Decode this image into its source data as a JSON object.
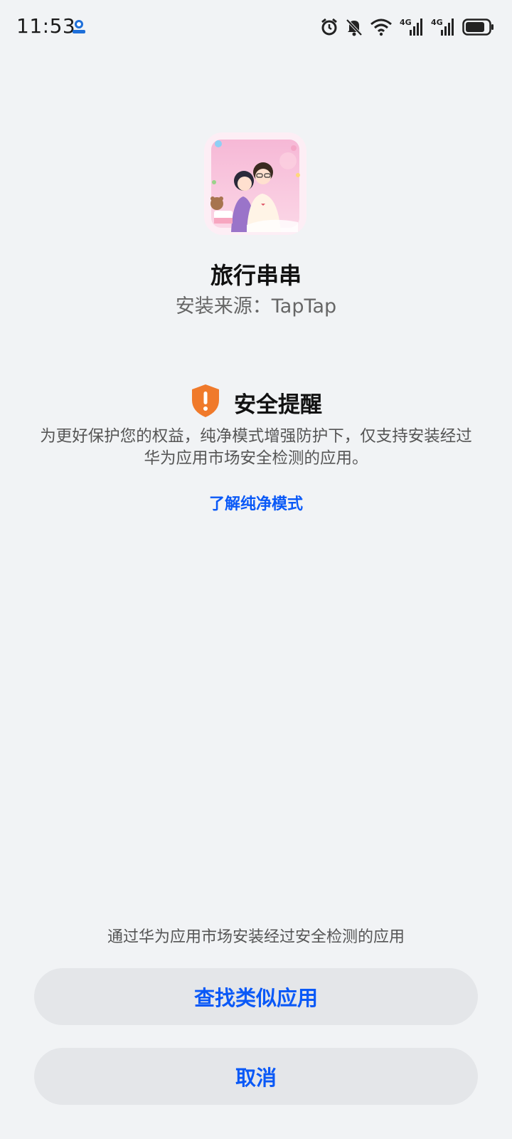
{
  "status_bar": {
    "time": "11:53",
    "icons": [
      "app-notification-icon",
      "alarm-icon",
      "mute-icon",
      "wifi-icon",
      "signal-4g-icon",
      "signal-4g-icon",
      "battery-icon"
    ],
    "network_labels": [
      "4G",
      "4G"
    ]
  },
  "app": {
    "name": "旅行串串",
    "install_source": "安装来源：TapTap"
  },
  "notice": {
    "icon": "shield-alert-icon",
    "title": "安全提醒",
    "body": "为更好保护您的权益，纯净模式增强防护下，仅支持安装经过华为应用市场安全检测的应用。",
    "link": "了解纯净模式"
  },
  "bottom": {
    "hint": "通过华为应用市场安装经过安全检测的应用",
    "find_button": "查找类似应用",
    "cancel_button": "取消"
  },
  "colors": {
    "background": "#f1f3f5",
    "accent": "#0a59f7",
    "warning": "#f07a2b",
    "button_bg": "#e4e6e9"
  }
}
